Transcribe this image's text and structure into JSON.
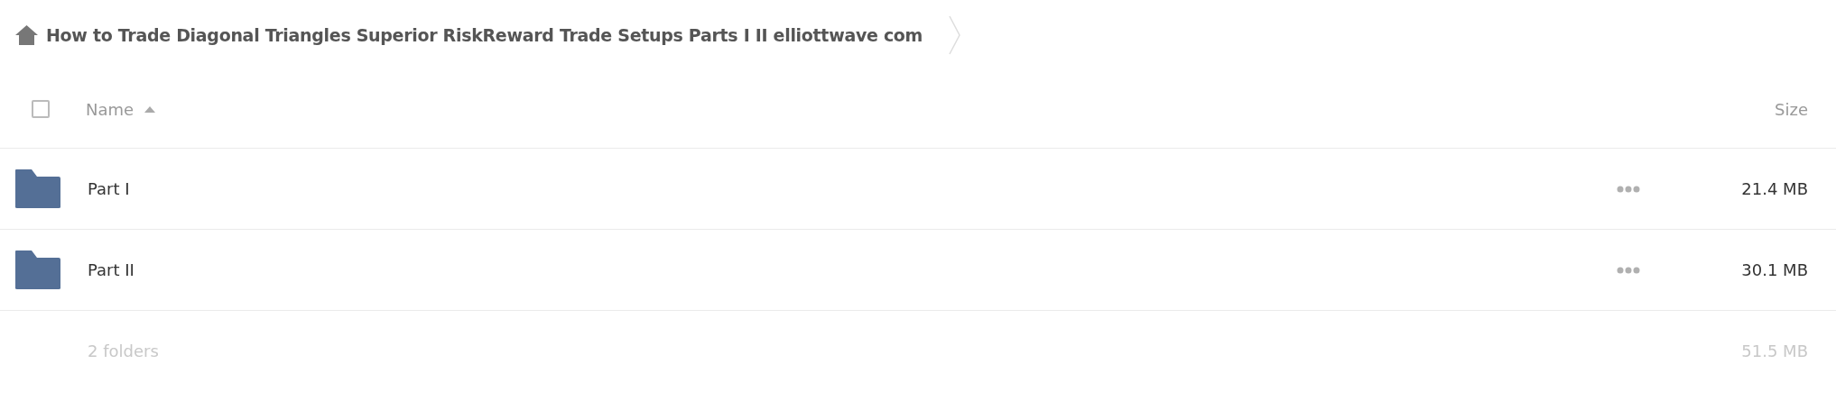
{
  "breadcrumb": {
    "title": "How to Trade Diagonal Triangles Superior RiskReward Trade Setups Parts I II elliottwave com"
  },
  "table": {
    "select_all": {
      "checked": false
    },
    "columns": [
      {
        "label": "Name",
        "sorted_ascending": true
      },
      {
        "label": "Size"
      }
    ],
    "rows": [
      {
        "kind": "folder",
        "name": "Part I",
        "size": "21.4 MB"
      },
      {
        "kind": "folder",
        "name": "Part II",
        "size": "30.1 MB"
      }
    ]
  },
  "footer": {
    "count": "2 folders",
    "total": "51.5 MB"
  }
}
